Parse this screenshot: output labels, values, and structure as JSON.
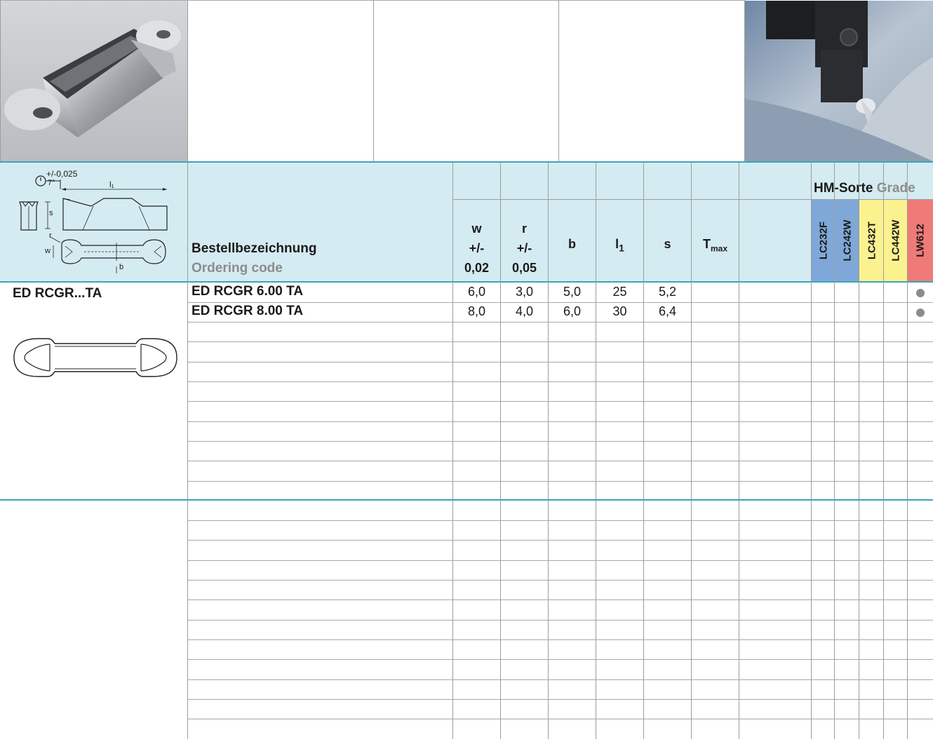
{
  "header": {
    "ordering_label_de": "Bestellbezeichnung",
    "ordering_label_en": "Ordering code",
    "grade_title_de": "HM-Sorte",
    "grade_title_en": "Grade",
    "diagram_tolerance": "+/-0,025",
    "diagram_angle": "7°",
    "diagram_l1": "l₁",
    "diagram_s": "s",
    "diagram_r": "r",
    "diagram_w": "w",
    "diagram_b": "b"
  },
  "columns": {
    "w": {
      "name": "w",
      "tol": "+/-",
      "val": "0,02"
    },
    "r": {
      "name": "r",
      "tol": "+/-",
      "val": "0,05"
    },
    "b": {
      "name": "b"
    },
    "l1": {
      "name": "l",
      "sub": "1"
    },
    "s": {
      "name": "s"
    },
    "tmax": {
      "name": "T",
      "sub": "max"
    }
  },
  "grades": [
    {
      "name": "LC232F",
      "color": "#7fa8d8"
    },
    {
      "name": "LC242W",
      "color": "#7fa8d8"
    },
    {
      "name": "LC432T",
      "color": "#fbf28f"
    },
    {
      "name": "LC442W",
      "color": "#fbf28f"
    },
    {
      "name": "LW612",
      "color": "#ef7a78"
    }
  ],
  "family": "ED RCGR...TA",
  "rows": [
    {
      "code": "ED RCGR 6.00 TA",
      "w": "6,0",
      "r": "3,0",
      "b": "5,0",
      "l1": "25",
      "s": "5,2",
      "tmax": "",
      "grades": [
        false,
        false,
        false,
        false,
        true
      ]
    },
    {
      "code": "ED RCGR 8.00 TA",
      "w": "8,0",
      "r": "4,0",
      "b": "6,0",
      "l1": "30",
      "s": "6,4",
      "tmax": "",
      "grades": [
        false,
        false,
        false,
        false,
        true
      ]
    }
  ],
  "icons": {
    "insert_photo": "grooving-insert-photo",
    "machining_photo": "tool-holder-machining-photo",
    "dimension_diagram": "insert-dimension-diagram",
    "insert_outline": "insert-top-view-outline"
  }
}
